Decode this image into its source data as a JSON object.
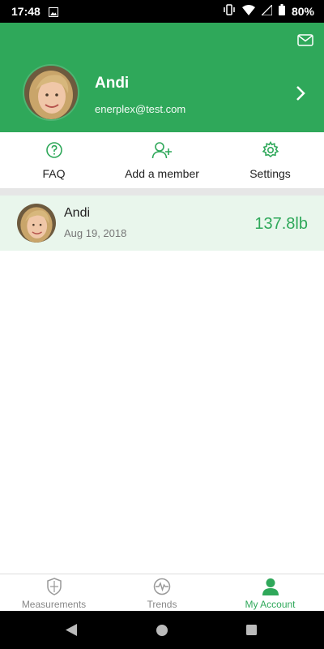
{
  "status": {
    "time": "17:48",
    "battery": "80%"
  },
  "profile": {
    "name": "Andi",
    "email": "enerplex@test.com"
  },
  "actions": [
    {
      "label": "FAQ",
      "icon": "question-circle-icon"
    },
    {
      "label": "Add a member",
      "icon": "add-user-icon"
    },
    {
      "label": "Settings",
      "icon": "gear-icon"
    }
  ],
  "member": {
    "name": "Andi",
    "date": "Aug 19, 2018",
    "weight": "137.8lb"
  },
  "tabs": [
    {
      "label": "Measurements",
      "icon": "shield-icon"
    },
    {
      "label": "Trends",
      "icon": "pulse-icon"
    },
    {
      "label": "My Account",
      "icon": "person-icon",
      "active": true
    }
  ],
  "colors": {
    "brand": "#2fa85a",
    "member_row_bg": "#e9f6ec"
  }
}
